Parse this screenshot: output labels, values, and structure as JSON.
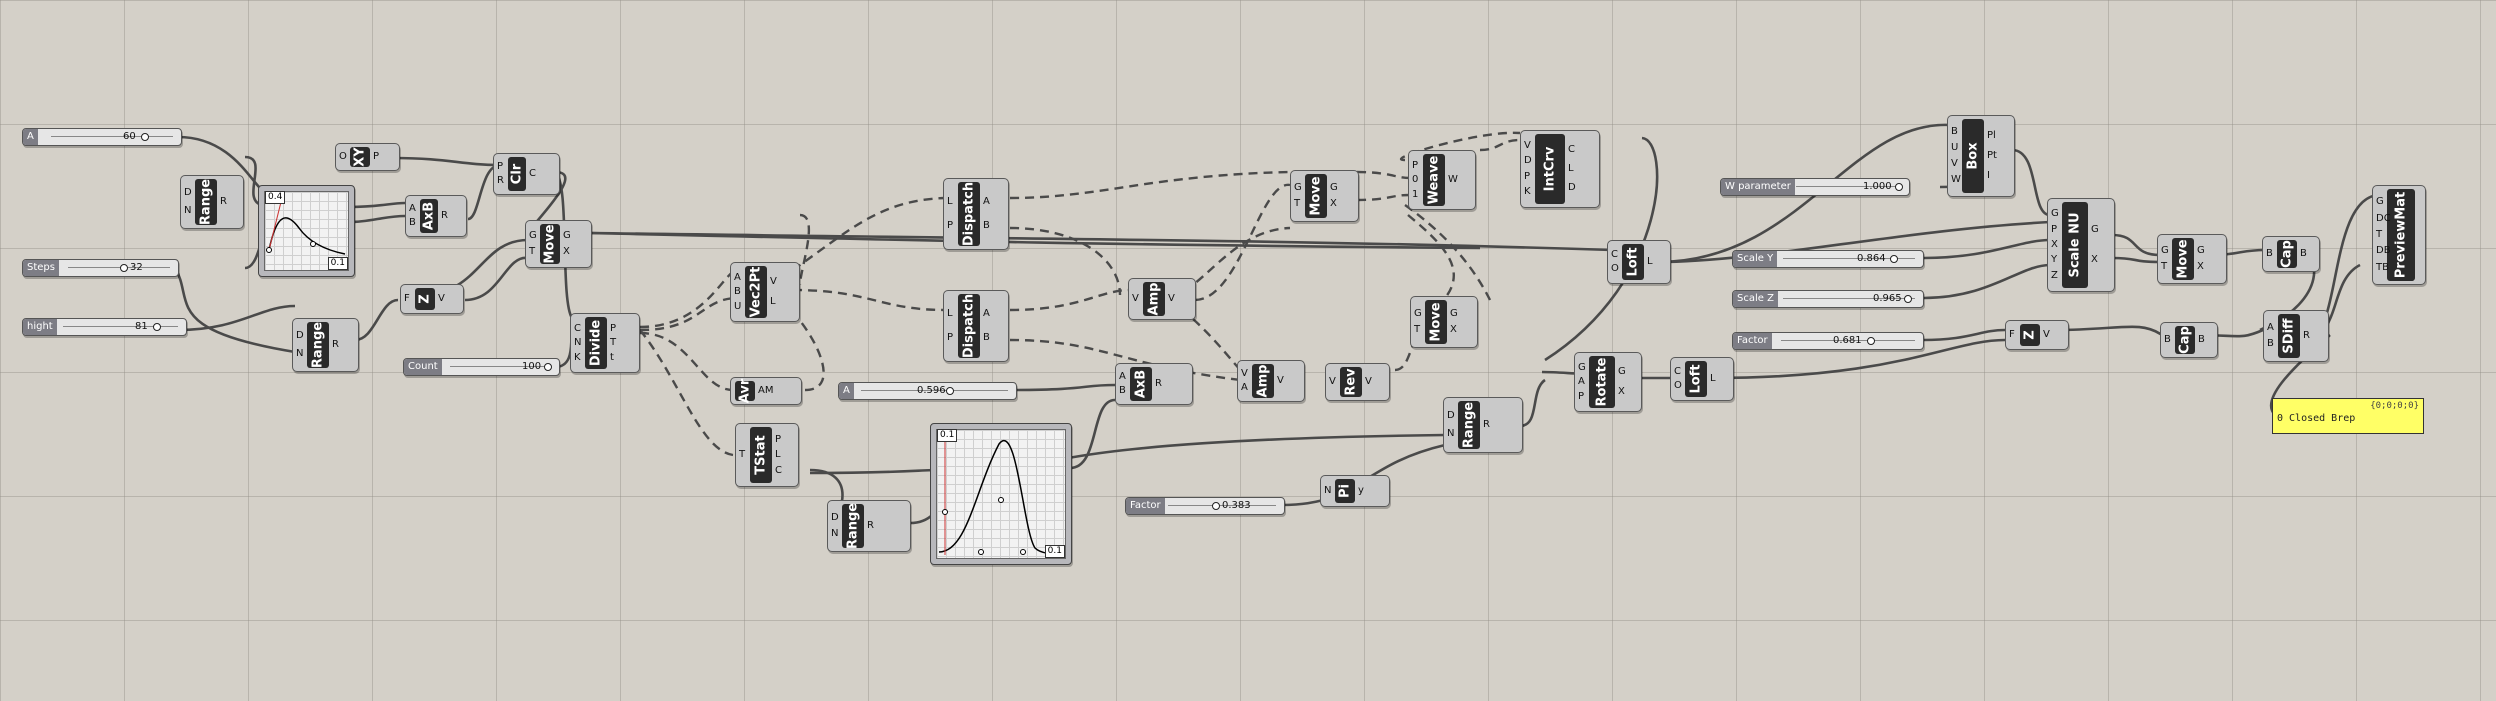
{
  "components": {
    "range1": {
      "name": "Range",
      "inputs": [
        "D",
        "N"
      ],
      "outputs": [
        "R"
      ]
    },
    "axb": {
      "name": "AxB",
      "inputs": [
        "A",
        "B"
      ],
      "outputs": [
        "R"
      ]
    },
    "xy": {
      "name": "XY",
      "inputs": [
        "O"
      ],
      "outputs": [
        "P"
      ]
    },
    "clr": {
      "name": "Clr",
      "inputs": [
        "P",
        "R"
      ],
      "outputs": [
        "C"
      ]
    },
    "zvec": {
      "name": "Z",
      "inputs": [
        "F"
      ],
      "outputs": [
        "V"
      ]
    },
    "range2": {
      "name": "Range",
      "inputs": [
        "D",
        "N"
      ],
      "outputs": [
        "R"
      ]
    },
    "move1": {
      "name": "Move",
      "inputs": [
        "G",
        "T"
      ],
      "outputs": [
        "G",
        "X"
      ]
    },
    "divide": {
      "name": "Divide",
      "inputs": [
        "C",
        "N",
        "K"
      ],
      "outputs": [
        "P",
        "T",
        "t"
      ]
    },
    "vec2pt": {
      "name": "Vec2Pt",
      "inputs": [
        "A",
        "B",
        "U"
      ],
      "outputs": [
        "V",
        "L"
      ]
    },
    "avr": {
      "name": "Avr",
      "inputs": [],
      "outputs": [
        "AM"
      ]
    },
    "tstat": {
      "name": "TStat",
      "inputs": [
        "T"
      ],
      "outputs": [
        "P",
        "L",
        "C"
      ]
    },
    "range3": {
      "name": "Range",
      "inputs": [
        "D",
        "N"
      ],
      "outputs": [
        "R"
      ]
    },
    "dispatch1": {
      "name": "Dispatch",
      "inputs": [
        "L",
        "P"
      ],
      "outputs": [
        "A",
        "B"
      ]
    },
    "dispatch2": {
      "name": "Dispatch",
      "inputs": [
        "L",
        "P"
      ],
      "outputs": [
        "A",
        "B"
      ]
    },
    "amp1": {
      "name": "Amp",
      "inputs": [
        "V"
      ],
      "outputs": [
        "V"
      ]
    },
    "axb2": {
      "name": "AxB",
      "inputs": [
        "A",
        "B"
      ],
      "outputs": [
        "R"
      ]
    },
    "amp2": {
      "name": "Amp",
      "inputs": [
        "V",
        "A"
      ],
      "outputs": [
        "V"
      ]
    },
    "rev": {
      "name": "Rev",
      "inputs": [
        "V"
      ],
      "outputs": [
        "V"
      ]
    },
    "move2": {
      "name": "Move",
      "inputs": [
        "G",
        "T"
      ],
      "outputs": [
        "G",
        "X"
      ]
    },
    "move3": {
      "name": "Move",
      "inputs": [
        "G",
        "T"
      ],
      "outputs": [
        "G",
        "X"
      ]
    },
    "weave": {
      "name": "Weave",
      "inputs": [
        "P",
        "0",
        "1"
      ],
      "outputs": [
        "W"
      ]
    },
    "intcrv": {
      "name": "IntCrv",
      "inputs": [
        "V",
        "D",
        "P",
        "K"
      ],
      "outputs": [
        "C",
        "L",
        "D"
      ]
    },
    "pi": {
      "name": "Pi",
      "inputs": [
        "N"
      ],
      "outputs": [
        "y"
      ]
    },
    "range4": {
      "name": "Range",
      "inputs": [
        "D",
        "N"
      ],
      "outputs": [
        "R"
      ]
    },
    "rotate": {
      "name": "Rotate",
      "inputs": [
        "G",
        "A",
        "P"
      ],
      "outputs": [
        "G",
        "X"
      ]
    },
    "loft1": {
      "name": "Loft",
      "inputs": [
        "C",
        "O"
      ],
      "outputs": [
        "L"
      ]
    },
    "loft2": {
      "name": "Loft",
      "inputs": [
        "C",
        "O"
      ],
      "outputs": [
        "L"
      ]
    },
    "box": {
      "name": "Box",
      "inputs": [
        "B",
        "U",
        "V",
        "W"
      ],
      "outputs": [
        "Pl",
        "Pt",
        "I"
      ]
    },
    "scalenu": {
      "name": "Scale NU",
      "inputs": [
        "G",
        "P",
        "X",
        "Y",
        "Z"
      ],
      "outputs": [
        "G",
        "X"
      ]
    },
    "move4": {
      "name": "Move",
      "inputs": [
        "G",
        "T"
      ],
      "outputs": [
        "G",
        "X"
      ]
    },
    "cap1": {
      "name": "Cap",
      "inputs": [
        "B"
      ],
      "outputs": [
        "B"
      ]
    },
    "zvec2": {
      "name": "Z",
      "inputs": [
        "F"
      ],
      "outputs": [
        "V"
      ]
    },
    "cap2": {
      "name": "Cap",
      "inputs": [
        "B"
      ],
      "outputs": [
        "B"
      ]
    },
    "sdiff": {
      "name": "SDiff",
      "inputs": [
        "A",
        "B"
      ],
      "outputs": [
        "R"
      ]
    },
    "previewmat": {
      "name": "PreviewMat",
      "inputs": [
        "G",
        "DC",
        "T",
        "DB",
        "TB"
      ],
      "outputs": []
    }
  },
  "sliders": {
    "a": {
      "name": "A",
      "value": "60"
    },
    "steps": {
      "name": "Steps",
      "value": "32"
    },
    "hight": {
      "name": "hight",
      "value": "81"
    },
    "count": {
      "name": "Count",
      "value": "100"
    },
    "a2": {
      "name": "A",
      "value": "0.596"
    },
    "factor1": {
      "name": "Factor",
      "value": "0.383"
    },
    "wparam": {
      "name": "W parameter",
      "value": "1.000"
    },
    "scaley": {
      "name": "Scale Y",
      "value": "0.864"
    },
    "scalez": {
      "name": "Scale Z",
      "value": "0.965"
    },
    "factor2": {
      "name": "Factor",
      "value": "0.681"
    }
  },
  "graphs": {
    "g1": {
      "tag_tl": "0.4",
      "tag_br": "0.1"
    },
    "g2": {
      "tag_tl": "0.1",
      "tag_br": "0.1"
    }
  },
  "panel": {
    "header": "{0;0;0;0}",
    "line": "0 Closed Brep"
  },
  "colors": {
    "canvas": "#d4d0c8",
    "component": "#c9c9c9",
    "core": "#2a2a2a",
    "panel": "#ffff66"
  }
}
